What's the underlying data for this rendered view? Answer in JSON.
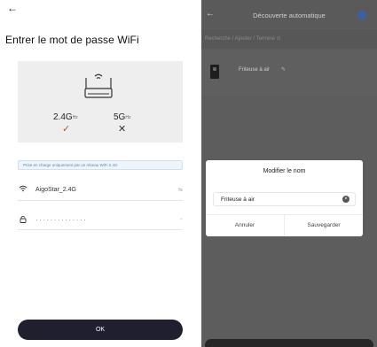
{
  "left": {
    "back_icon": "arrow-left",
    "title": "Entrer le mot de passe WiFi",
    "bands": [
      {
        "label": "2.4G",
        "unit": "Hz",
        "status": "✓",
        "status_name": "check-icon",
        "supported": true
      },
      {
        "label": "5G",
        "unit": "Hz",
        "status": "✕",
        "status_name": "cross-icon",
        "supported": false
      }
    ],
    "notice": "Prise en charge uniquement par un réseau WiFi 2.4G",
    "ssid_value": "AigoStar_2.4G",
    "password_value": "··············",
    "ok_label": "OK"
  },
  "right": {
    "back_icon": "arrow-left",
    "title": "Découverte automatique",
    "breadcrumb": "Recherche / Ajouter / Terminé ⊙",
    "device_name": "Friteuse à air",
    "dialog": {
      "title": "Modifier le nom",
      "input_value": "Friteuse à air",
      "cancel_label": "Annuler",
      "save_label": "Sauvegarder"
    }
  },
  "colors": {
    "primary_button": "#1f1f2e",
    "check": "#b05a22",
    "notice_text": "#5a86c0",
    "overlay": "#5d5d5d",
    "accent_dot": "#3b5ea8"
  }
}
